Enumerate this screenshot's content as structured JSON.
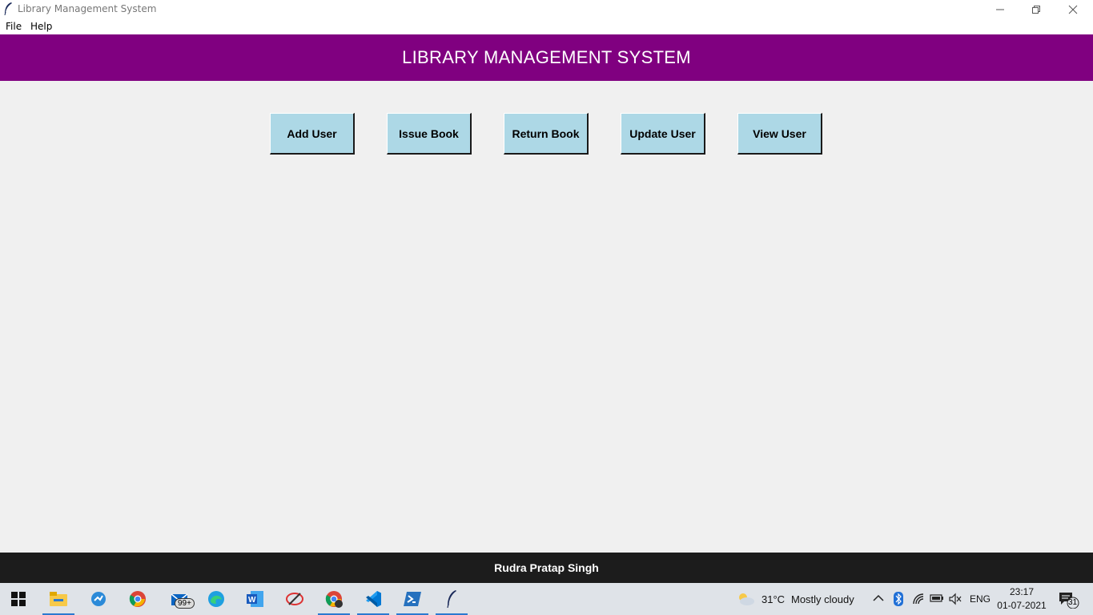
{
  "window": {
    "title": "Library Management System",
    "controls": [
      "minimize",
      "restore",
      "close"
    ]
  },
  "menu": {
    "items": [
      {
        "label": "File"
      },
      {
        "label": "Help"
      }
    ]
  },
  "header": {
    "title": "LIBRARY MANAGEMENT SYSTEM",
    "background": "#800080"
  },
  "actions": {
    "button_color": "#add8e6",
    "buttons": [
      {
        "label": "Add User"
      },
      {
        "label": "Issue Book"
      },
      {
        "label": "Return Book"
      },
      {
        "label": "Update User"
      },
      {
        "label": "View User"
      }
    ]
  },
  "footer": {
    "author": "Rudra Pratap Singh"
  },
  "taskbar": {
    "apps": [
      {
        "icon": "file-explorer-icon",
        "active": true
      },
      {
        "icon": "generic-app-icon",
        "active": false
      },
      {
        "icon": "chrome-icon",
        "active": false
      },
      {
        "icon": "mail-icon",
        "badge": "99+",
        "active": false
      },
      {
        "icon": "edge-icon",
        "active": false
      },
      {
        "icon": "word-icon",
        "active": false
      },
      {
        "icon": "snipping-tool-icon",
        "active": false
      },
      {
        "icon": "chrome-profile-icon",
        "active": true
      },
      {
        "icon": "vscode-icon",
        "active": true
      },
      {
        "icon": "powershell-icon",
        "active": true
      },
      {
        "icon": "python-feather-icon",
        "active": true
      }
    ],
    "weather": {
      "temp": "31°C",
      "condition": "Mostly cloudy"
    },
    "language": "ENG",
    "time": "23:17",
    "date": "01-07-2021",
    "notification_count": "31"
  }
}
